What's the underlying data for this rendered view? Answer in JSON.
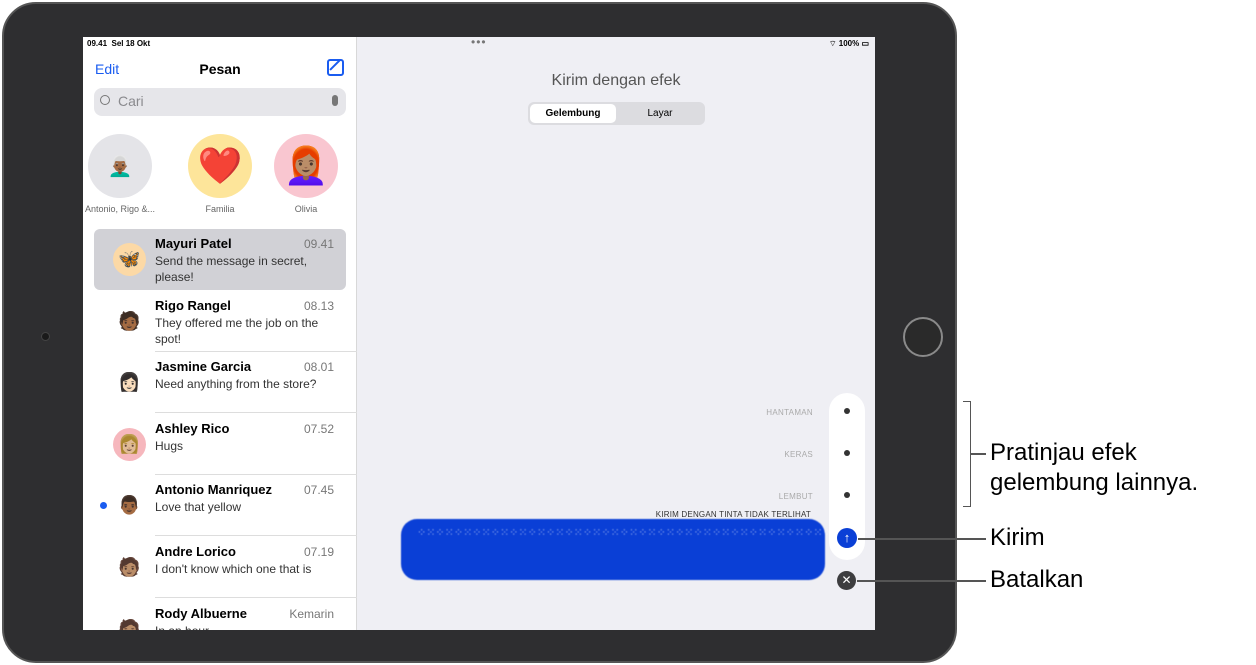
{
  "status": {
    "time": "09.41",
    "date": "Sel 18 Okt",
    "battery": "100%"
  },
  "header": {
    "edit": "Edit",
    "title": "Pesan"
  },
  "search": {
    "placeholder": "Cari"
  },
  "pinned": [
    {
      "name": "Antonio, Rigo &...",
      "icon": "group-memoji"
    },
    {
      "name": "Familia",
      "icon": "❤️"
    },
    {
      "name": "Olivia",
      "icon": "👩🏽‍🦰"
    }
  ],
  "conversations": [
    {
      "name": "Mayuri Patel",
      "time": "09.41",
      "snippet": "Send the message in secret, please!",
      "avatar": "🦋",
      "selected": true
    },
    {
      "name": "Rigo Rangel",
      "time": "08.13",
      "snippet": "They offered me the job on the spot!",
      "avatar": "🧑🏾"
    },
    {
      "name": "Jasmine Garcia",
      "time": "08.01",
      "snippet": "Need anything from the store?",
      "avatar": "👩🏻"
    },
    {
      "name": "Ashley Rico",
      "time": "07.52",
      "snippet": "Hugs",
      "avatar": "👩🏼"
    },
    {
      "name": "Antonio Manriquez",
      "time": "07.45",
      "snippet": "Love that yellow",
      "avatar": "👨🏾",
      "unread": true
    },
    {
      "name": "Andre Lorico",
      "time": "07.19",
      "snippet": "I don't know which one that is",
      "avatar": "🧑🏽"
    },
    {
      "name": "Rody Albuerne",
      "time": "Kemarin",
      "snippet": "In an hour",
      "avatar": "🧑🏽"
    }
  ],
  "effects": {
    "title": "Kirim dengan efek",
    "tabs": [
      "Gelembung",
      "Layar"
    ],
    "options": [
      "HANTAMAN",
      "KERAS",
      "LEMBUT"
    ],
    "invisible_ink": "KIRIM DENGAN TINTA TIDAK TERLIHAT",
    "bubble_text": "⁘⁙⁘⁙⁘⁙⁘⁙⁘⁙⁘⁙⁘⁙⁘⁙⁘⁙⁘⁙⁘⁙⁘⁙⁘⁙⁘⁙⁘⁙⁘⁙⁘⁙⁘⁙⁘⁙⁘⁙⁘⁙⁘⁙⁘⁙⁘⁙⁘⁙⁘⁙⁘⁙⁘⁙⁘⁙⁘⁙⁘⁙⁘⁙⁘⁙⁘⁙⁘⁙⁘⁙⁘⁙⁘⁙⁘⁙⁘⁙⁘⁙⁘⁙⁘⁙⁘⁙⁘⁙⁘⁙⁘⁙⁘⁙⁘⁙⁘⁙⁘⁙⁘⁙⁘⁙⁘⁙",
    "send_icon": "↑",
    "cancel_icon": "✕",
    "accent": "#0a3fd6"
  },
  "annotations": {
    "preview": "Pratinjau efek gelembung lainnya.",
    "send": "Kirim",
    "cancel": "Batalkan"
  }
}
